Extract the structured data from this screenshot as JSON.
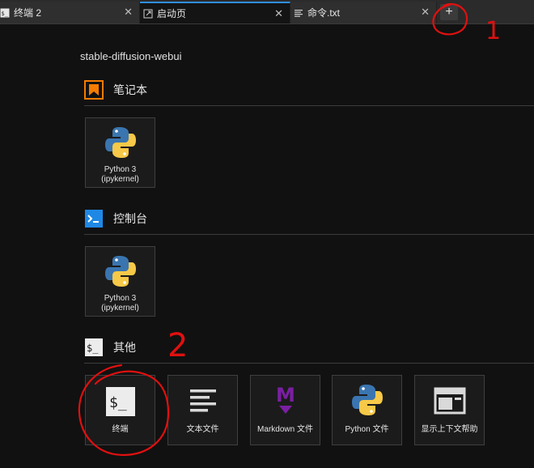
{
  "tabs": [
    {
      "label": "终端 2",
      "icon": "terminal-icon",
      "active": false,
      "close": "✕"
    },
    {
      "label": "启动页",
      "icon": "launcher-icon",
      "active": true,
      "close": "✕"
    },
    {
      "label": "命令.txt",
      "icon": "text-file-icon",
      "active": false,
      "close": "✕"
    }
  ],
  "add_tab_label": "+",
  "cwd": "stable-diffusion-webui",
  "sections": {
    "notebook": {
      "title": "笔记本",
      "icon": "notebook-icon",
      "accent": "#f57c00"
    },
    "console": {
      "title": "控制台",
      "icon": "console-icon",
      "accent": "#1e88e5"
    },
    "other": {
      "title": "其他",
      "icon": "terminal-icon"
    }
  },
  "notebook_cards": [
    {
      "line1": "Python 3",
      "line2": "(ipykernel)",
      "icon": "python-icon"
    }
  ],
  "console_cards": [
    {
      "line1": "Python 3",
      "line2": "(ipykernel)",
      "icon": "python-icon"
    }
  ],
  "other_cards": [
    {
      "label": "终端",
      "icon": "terminal-icon"
    },
    {
      "label": "文本文件",
      "icon": "text-file-icon"
    },
    {
      "label": "Markdown 文件",
      "icon": "markdown-icon",
      "accent": "#7b1fa2"
    },
    {
      "label": "Python 文件",
      "icon": "python-icon"
    },
    {
      "label": "显示上下文帮助",
      "icon": "context-help-icon"
    }
  ],
  "annotations": [
    "1",
    "2"
  ],
  "colors": {
    "annotation": "#e01010",
    "active_tab_border": "#2f8ee8",
    "python_blue": "#3a75b0",
    "python_yellow": "#f7c948"
  }
}
